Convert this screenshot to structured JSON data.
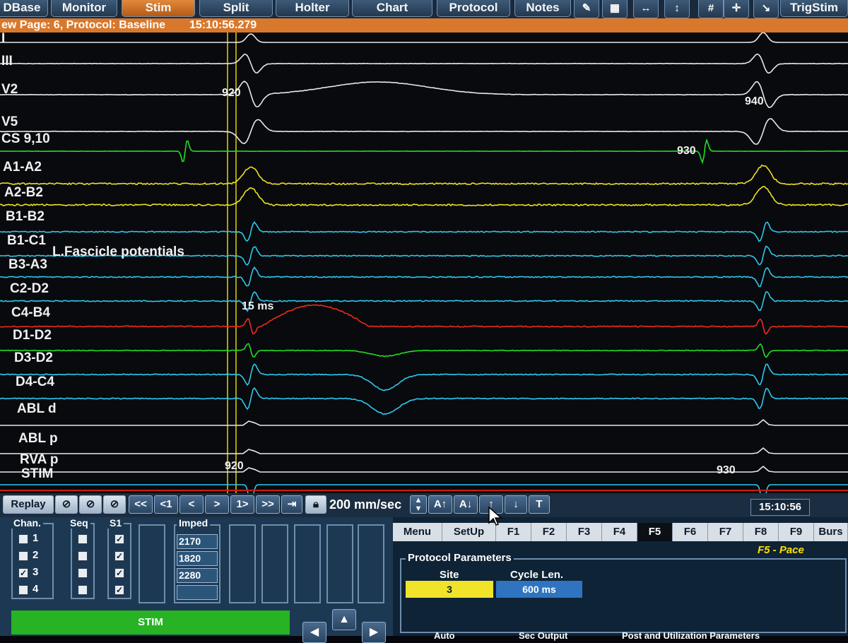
{
  "toolbar": {
    "tabs": [
      {
        "label": "DBase",
        "highlight": "D"
      },
      {
        "label": "Monitor",
        "highlight": "r"
      },
      {
        "label": "Stim",
        "highlight": "S"
      },
      {
        "label": "Split",
        "highlight": "l"
      },
      {
        "label": "Holter",
        "highlight": "H"
      },
      {
        "label": "Chart",
        "highlight": ""
      },
      {
        "label": "Protocol",
        "highlight": "co"
      },
      {
        "label": "Notes",
        "highlight": "N"
      }
    ],
    "trigstim_label": "TrigStim",
    "icons": [
      "syringe-icon",
      "grid-icon",
      "horizontal-caliper-icon",
      "vertical-caliper-icon",
      "hash-icon",
      "crosshair-icon",
      "arrow-icon"
    ]
  },
  "status": {
    "page_info": "ew Page: 6, Protocol: Baseline",
    "timestamp": "15:10:56.279"
  },
  "channels": [
    {
      "name": "I",
      "color": "#e8e8e8"
    },
    {
      "name": "III",
      "color": "#e8e8e8"
    },
    {
      "name": "V2",
      "color": "#e8e8e8"
    },
    {
      "name": "V5",
      "color": "#e8e8e8"
    },
    {
      "name": "CS 9,10",
      "color": "#22dd22"
    },
    {
      "name": "A1-A2",
      "color": "#f0e020"
    },
    {
      "name": "A2-B2",
      "color": "#f0e020"
    },
    {
      "name": "B1-B2",
      "color": "#2ec8ec"
    },
    {
      "name": "B1-C1",
      "color": "#2ec8ec"
    },
    {
      "name": "B3-A3",
      "color": "#2ec8ec"
    },
    {
      "name": "C2-D2",
      "color": "#2ec8ec"
    },
    {
      "name": "C4-B4",
      "color": "#ee2a16"
    },
    {
      "name": "D1-D2",
      "color": "#22dd22"
    },
    {
      "name": "D3-D2",
      "color": "#2ec8ec"
    },
    {
      "name": "D4-C4",
      "color": "#2ec8ec"
    },
    {
      "name": "ABL d",
      "color": "#e8e8e8"
    },
    {
      "name": "ABL p",
      "color": "#e8e8e8"
    },
    {
      "name": "RVA p",
      "color": "#e8e8e8"
    },
    {
      "name": "STIM",
      "color": "#2ec8ec"
    }
  ],
  "annotations": {
    "fascicle": "L.Fascicle potentials",
    "interval": "15 ms",
    "v2_left": "920",
    "v2_right": "940",
    "cs_right": "930",
    "rva_left": "920",
    "rva_right": "930"
  },
  "replay": {
    "replay_label": "Replay",
    "buttons": [
      "<<",
      "<1",
      "<",
      ">",
      "1>",
      ">>"
    ],
    "speed": "200 mm/sec",
    "gain_up": "A↑",
    "gain_down": "A↓",
    "up": "↑",
    "down": "↓",
    "t_label": "T",
    "clock": "15:10:56"
  },
  "panel": {
    "chan_header": "Chan.",
    "seq_header": "Seq",
    "s1_header": "S1",
    "imped_header": "Imped",
    "channels": [
      {
        "label": "1",
        "checked": false
      },
      {
        "label": "2",
        "checked": false
      },
      {
        "label": "3",
        "checked": true
      },
      {
        "label": "4",
        "checked": false
      }
    ],
    "s1_checked": [
      true,
      true,
      true,
      true
    ],
    "impedances": [
      "2170",
      "1820",
      "2280",
      ""
    ],
    "stim_label": "STIM"
  },
  "functions": {
    "tabs": [
      "Menu",
      "SetUp",
      "F1",
      "F2",
      "F3",
      "F4",
      "F5",
      "F6",
      "F7",
      "F8",
      "F9",
      "Burs"
    ],
    "selected": "F5",
    "f5_title": "F5  - Pace",
    "protocol_header": "Protocol Parameters",
    "site_label": "Site",
    "site_value": "3",
    "cycle_label": "Cycle Len.",
    "cycle_value": "600 ms",
    "partial_labels": [
      "Auto",
      "Sec Output",
      "Post and Utilization Parameters"
    ]
  }
}
